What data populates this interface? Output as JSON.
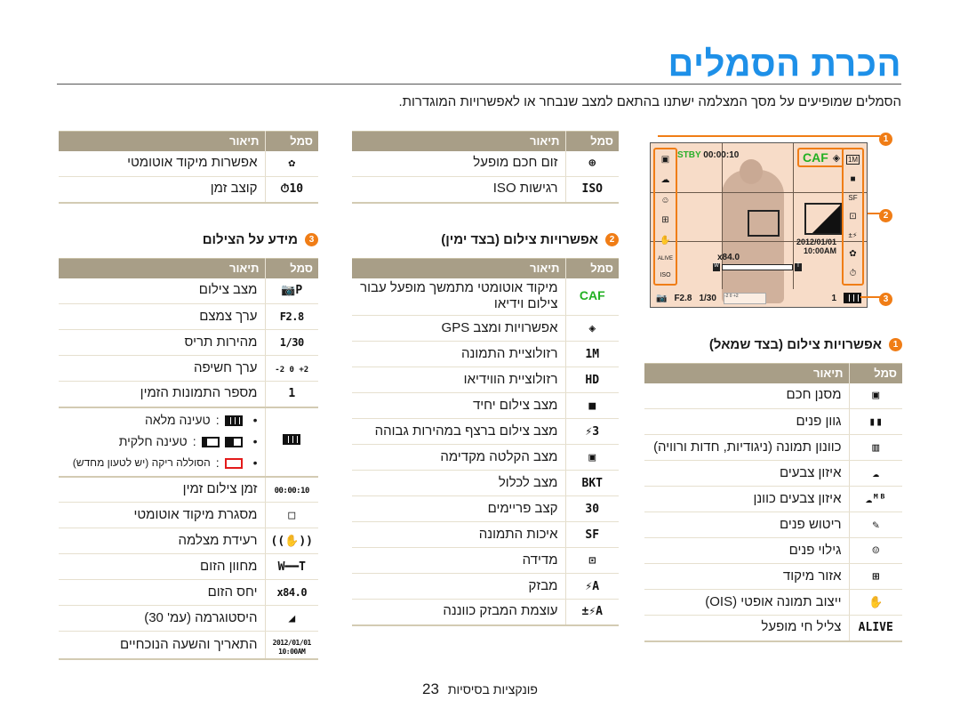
{
  "page": {
    "title": "הכרת הסמלים",
    "intro": "הסמלים שמופיעים על מסך המצלמה ישתנו בהתאם למצב שנבחר או לאפשרויות המוגדרות.",
    "accent_color": "#1e90e8",
    "header_color": "#a89e87",
    "badge_color": "#f07d16"
  },
  "table_headers": {
    "symbol": "סמל",
    "description": "תיאור"
  },
  "camera_screen": {
    "stby_label": "STBY",
    "rec_time": "00:00:10",
    "caf_label": "CAF",
    "date": "2012/01/01",
    "time": "10:00AM",
    "zoom_ratio": "x84.0",
    "zoom_w": "W",
    "zoom_t": "T",
    "aperture": "F2.8",
    "shutter": "1/30",
    "shots": "1",
    "ev_scale": "-2  0  +2",
    "callouts": [
      "1",
      "2",
      "3"
    ]
  },
  "section1": {
    "number": "1",
    "title": "אפשרויות צילום (בצד שמאל)",
    "rows": [
      {
        "icon": "smart-filter-icon",
        "glyph": "▣",
        "desc": "מסנן חכם"
      },
      {
        "icon": "skin-tone-icon",
        "glyph": "▮▮",
        "desc": "גוון פנים"
      },
      {
        "icon": "image-adjust-icon",
        "glyph": "▥",
        "desc": "כוונון תמונה (ניגודיות, חדות ורוויה)"
      },
      {
        "icon": "white-balance-icon",
        "glyph": "☁",
        "desc": "איזון צבעים"
      },
      {
        "icon": "custom-white-balance-icon",
        "glyph": "☁ᴹᴮ",
        "desc": "איזון צבעים כוונן"
      },
      {
        "icon": "face-retouch-icon",
        "glyph": "✎",
        "desc": "ריטוש פנים"
      },
      {
        "icon": "face-detection-icon",
        "glyph": "☺",
        "desc": "גילוי פנים"
      },
      {
        "icon": "focus-area-icon",
        "glyph": "⊞",
        "desc": "אזור מיקוד"
      },
      {
        "icon": "ois-icon",
        "glyph": "✋",
        "desc": "ייצוב תמונה אופטי (OIS)"
      },
      {
        "icon": "live-panorama-icon",
        "glyph": "ALIVE",
        "desc": "צליל חי מופעל"
      }
    ]
  },
  "section_mid_top": {
    "rows": [
      {
        "icon": "smart-zoom-icon",
        "glyph": "⊕",
        "desc": "זום חכם מופעל"
      },
      {
        "icon": "iso-icon",
        "glyph": "ISO",
        "desc": "רגישות ISO"
      }
    ]
  },
  "section2": {
    "number": "2",
    "title": "אפשרויות צילום (בצד ימין)",
    "rows": [
      {
        "icon": "caf-icon",
        "glyph": "CAF",
        "desc": "מיקוד אוטומטי מתמשך מופעל עבור צילום וידיאו"
      },
      {
        "icon": "gps-icon",
        "glyph": "◈",
        "desc": "אפשרויות ומצב GPS"
      },
      {
        "icon": "photo-resolution-icon",
        "glyph": "1M",
        "desc": "רזולוציית התמונה"
      },
      {
        "icon": "video-resolution-icon",
        "glyph": "HD",
        "desc": "רזולוציית הווידיאו"
      },
      {
        "icon": "single-shot-icon",
        "glyph": "■",
        "desc": "מצב צילום יחיד"
      },
      {
        "icon": "high-speed-burst-icon",
        "glyph": "⚡3",
        "desc": "מצב צילום ברצף במהירות גבוהה"
      },
      {
        "icon": "precapture-icon",
        "glyph": "▣",
        "desc": "מצב הקלטה מקדימה"
      },
      {
        "icon": "bracket-icon",
        "glyph": "BKT",
        "desc": "מצב לכלול"
      },
      {
        "icon": "frame-rate-icon",
        "glyph": "30",
        "desc": "קצב פריימים"
      },
      {
        "icon": "image-quality-icon",
        "glyph": "SF",
        "desc": "איכות התמונה"
      },
      {
        "icon": "metering-icon",
        "glyph": "⊡",
        "desc": "מדידה"
      },
      {
        "icon": "flash-icon",
        "glyph": "⚡A",
        "desc": "מבזק"
      },
      {
        "icon": "flash-intensity-icon",
        "glyph": "±⚡A",
        "desc": "עוצמת המבזק כווננה"
      }
    ]
  },
  "section_left_top": {
    "rows": [
      {
        "icon": "auto-macro-icon",
        "glyph": "✿",
        "desc": "אפשרות מיקוד אוטומטי"
      },
      {
        "icon": "self-timer-icon",
        "glyph": "⏱10",
        "desc": "קוצב זמן"
      }
    ]
  },
  "section3": {
    "number": "3",
    "title": "מידע על הצילום",
    "rows": [
      {
        "icon": "shooting-mode-icon",
        "glyph": "📷P",
        "desc": "מצב צילום"
      },
      {
        "icon": "aperture-icon",
        "glyph": "F2.8",
        "desc": "ערך צמצם"
      },
      {
        "icon": "shutter-speed-icon",
        "glyph": "1/30",
        "desc": "מהירות תריס"
      },
      {
        "icon": "exposure-value-icon",
        "glyph": "-2 0 +2",
        "desc": "ערך חשיפה"
      },
      {
        "icon": "shots-remaining-icon",
        "glyph": "1",
        "desc": "מספר התמונות הזמין"
      }
    ],
    "battery": {
      "full": "טעינה מלאה",
      "partial": "טעינה חלקית",
      "empty": "הסוללה ריקה (יש לטעון מחדש)"
    },
    "rows_after": [
      {
        "icon": "recording-time-icon",
        "glyph": "00:00:10",
        "desc": "זמן צילום זמין"
      },
      {
        "icon": "af-frame-icon",
        "glyph": "□",
        "desc": "מסגרת מיקוד אוטומטי"
      },
      {
        "icon": "camera-shake-icon",
        "glyph": "((✋))",
        "desc": "רעידת מצלמה"
      },
      {
        "icon": "zoom-indicator-icon",
        "glyph": "W━━T",
        "desc": "מחוון הזום"
      },
      {
        "icon": "zoom-ratio-icon",
        "glyph": "x84.0",
        "desc": "יחס הזום"
      },
      {
        "icon": "histogram-icon",
        "glyph": "◢",
        "desc": "היסטוגרמה (עמ' 30)"
      },
      {
        "icon": "date-time-icon",
        "glyph": "2012/01/01 10:00AM",
        "desc": "התאריך והשעה הנוכחיים"
      }
    ]
  },
  "footer": {
    "section": "פונקציות בסיסיות",
    "page_number": "23"
  }
}
